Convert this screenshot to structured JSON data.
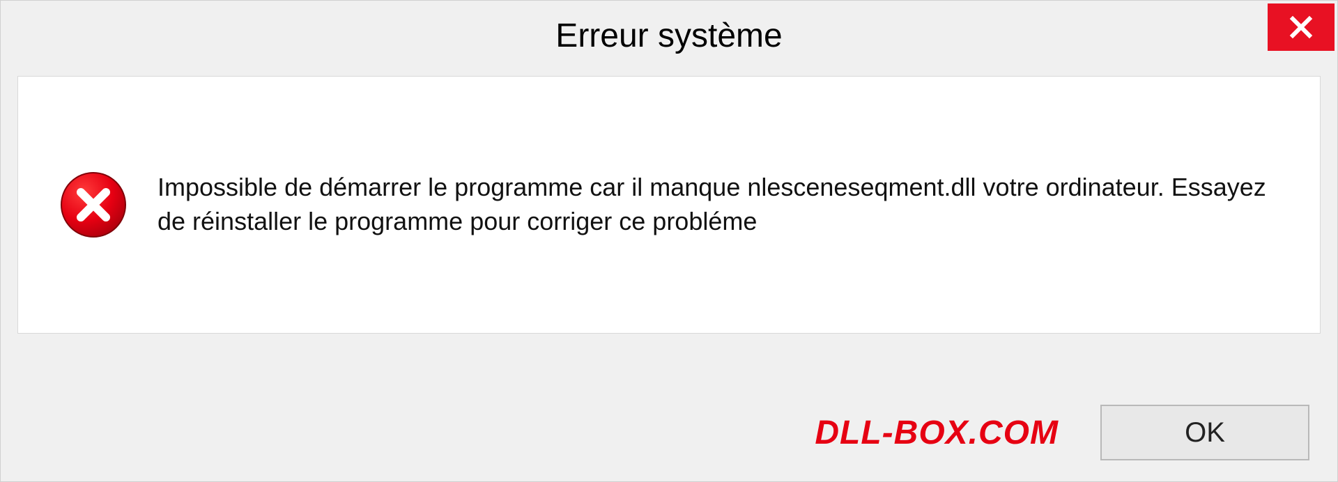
{
  "dialog": {
    "title": "Erreur système",
    "message": "Impossible de démarrer le programme car il manque nlesceneseqment.dll votre ordinateur. Essayez de réinstaller le programme pour corriger ce probléme",
    "ok_label": "OK"
  },
  "watermark": "DLL-BOX.COM",
  "colors": {
    "close_red": "#e81123",
    "error_red": "#e60012",
    "watermark_red": "#e60012"
  }
}
